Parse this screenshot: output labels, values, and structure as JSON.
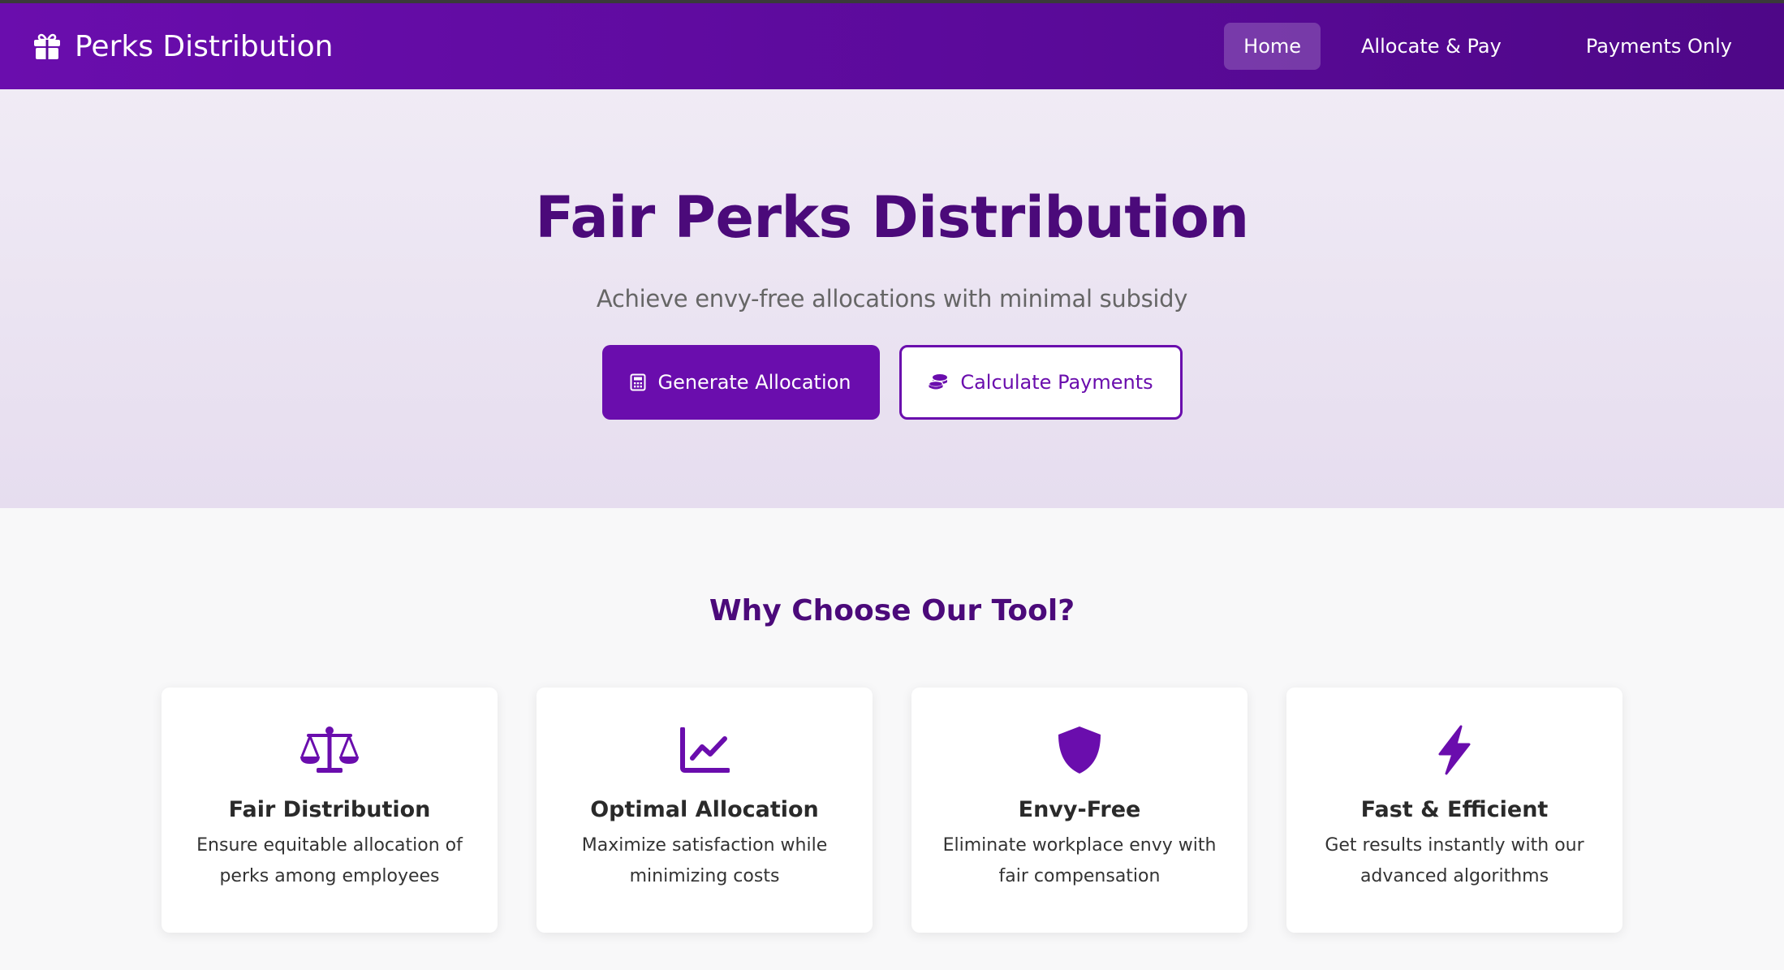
{
  "colors": {
    "accent": "#6a0dad",
    "heading": "#4b0a7a",
    "nav_bg": "#5a0a99"
  },
  "navbar": {
    "brand": {
      "icon": "gift-icon",
      "title": "Perks Distribution"
    },
    "items": [
      {
        "label": "Home",
        "active": true
      },
      {
        "label": "Allocate & Pay",
        "active": false
      },
      {
        "label": "Payments Only",
        "active": false
      }
    ]
  },
  "hero": {
    "title": "Fair Perks Distribution",
    "subtitle": "Achieve envy-free allocations with minimal subsidy",
    "primary_button": {
      "icon": "calculator-icon",
      "label": "Generate Allocation"
    },
    "secondary_button": {
      "icon": "coins-icon",
      "label": "Calculate Payments"
    }
  },
  "features": {
    "title": "Why Choose Our Tool?",
    "cards": [
      {
        "icon": "balance-scale-icon",
        "title": "Fair Distribution",
        "description": "Ensure equitable allocation of perks among employees"
      },
      {
        "icon": "chart-line-icon",
        "title": "Optimal Allocation",
        "description": "Maximize satisfaction while minimizing costs"
      },
      {
        "icon": "shield-icon",
        "title": "Envy-Free",
        "description": "Eliminate workplace envy with fair compensation"
      },
      {
        "icon": "bolt-icon",
        "title": "Fast & Efficient",
        "description": "Get results instantly with our advanced algorithms"
      }
    ]
  }
}
